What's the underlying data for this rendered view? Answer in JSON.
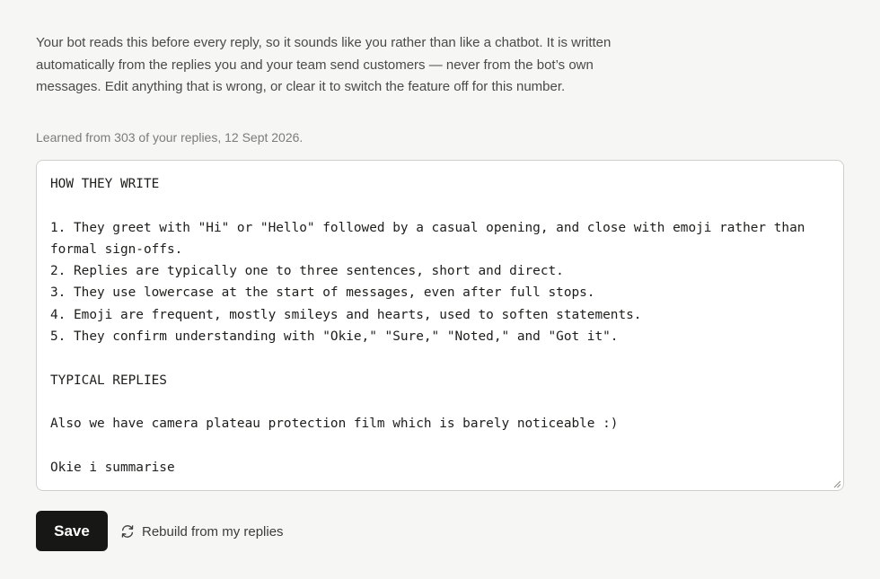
{
  "description": "Your bot reads this before every reply, so it sounds like you rather than like a chatbot. It is written automatically from the replies you and your team send customers — never from the bot’s own messages. Edit anything that is wrong, or clear it to switch the feature off for this number.",
  "learned_note": "Learned from 303 of your replies, 12 Sept 2026.",
  "editor": {
    "value": "HOW THEY WRITE\n\n1. They greet with \"Hi\" or \"Hello\" followed by a casual opening, and close with emoji rather than formal sign-offs.\n2. Replies are typically one to three sentences, short and direct.\n3. They use lowercase at the start of messages, even after full stops.\n4. Emoji are frequent, mostly smileys and hearts, used to soften statements.\n5. They confirm understanding with \"Okie,\" \"Sure,\" \"Noted,\" and \"Got it\".\n\nTYPICAL REPLIES\n\nAlso we have camera plateau protection film which is barely noticeable :)\n\nOkie i summarise"
  },
  "actions": {
    "save_label": "Save",
    "rebuild_label": "Rebuild from my replies",
    "rebuild_icon": "refresh-icon"
  }
}
